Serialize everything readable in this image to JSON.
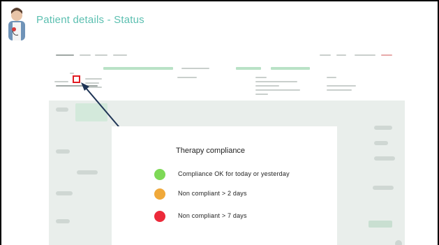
{
  "slide": {
    "title": "Patient details - Status"
  },
  "legend": {
    "title": "Therapy compliance",
    "items": [
      {
        "label": "Compliance OK for today or yesterday",
        "color": "#7ed957"
      },
      {
        "label": "Non compliant > 2 days",
        "color": "#f0a93a"
      },
      {
        "label": "Non compliant > 7 days",
        "color": "#ec2a3a"
      }
    ]
  },
  "colors": {
    "title_accent": "#5bbfb0",
    "marker": "#e11c22",
    "arrow": "#1f3556"
  }
}
